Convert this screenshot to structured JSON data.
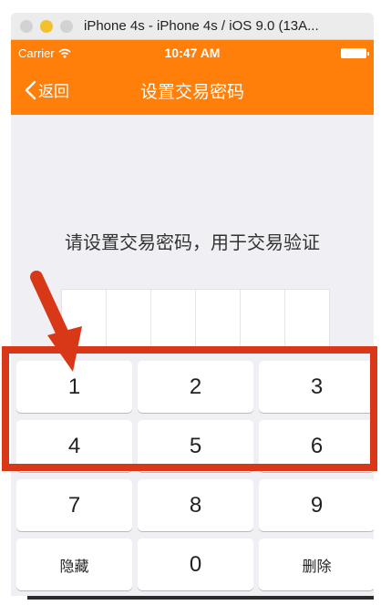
{
  "window": {
    "title": "iPhone 4s - iPhone 4s / iOS 9.0 (13A..."
  },
  "status_bar": {
    "carrier": "Carrier",
    "time": "10:47 AM"
  },
  "nav": {
    "back_label": "返回",
    "title": "设置交易密码"
  },
  "prompt": "请设置交易密码，用于交易验证",
  "password": {
    "length": 6
  },
  "keypad": {
    "keys": [
      "1",
      "2",
      "3",
      "4",
      "5",
      "6",
      "7",
      "8",
      "9",
      "隐藏",
      "0",
      "删除"
    ]
  },
  "colors": {
    "nav_orange": "#ff7f0a",
    "annotation_red": "#d93818",
    "background": "#efeff4"
  },
  "icons": {
    "wifi": "wifi-icon",
    "battery": "battery-icon",
    "back": "chevron-left-icon"
  }
}
